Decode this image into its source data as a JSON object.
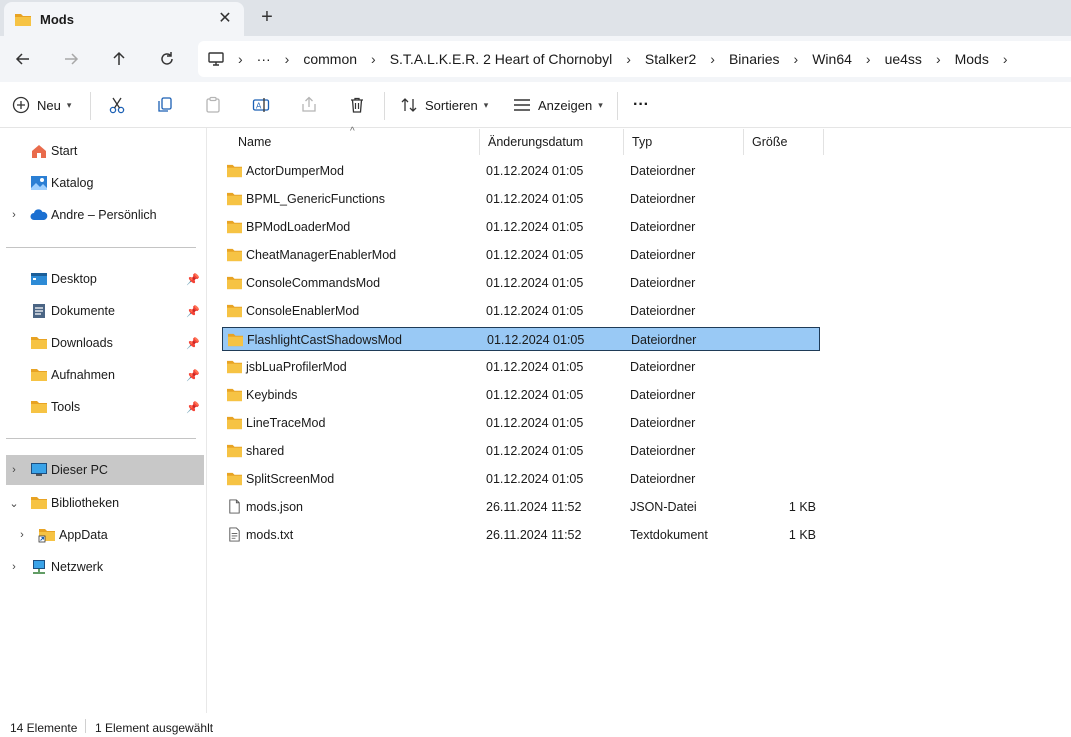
{
  "window": {
    "tab_title": "Mods",
    "tab_close_icon": "close-icon",
    "new_tab_icon": "plus-icon"
  },
  "nav": {
    "back_icon": "arrow-left-icon",
    "forward_icon": "arrow-right-icon",
    "up_icon": "arrow-up-icon",
    "refresh_icon": "refresh-icon",
    "breadcrumbs": [
      "common",
      "S.T.A.L.K.E.R. 2 Heart of Chornobyl",
      "Stalker2",
      "Binaries",
      "Win64",
      "ue4ss",
      "Mods"
    ],
    "overflow": "···"
  },
  "toolbar": {
    "new_label": "Neu",
    "sort_label": "Sortieren",
    "view_label": "Anzeigen",
    "more_label": "···"
  },
  "sidebar": {
    "groups": [
      [
        {
          "label": "Start",
          "icon": "home-icon",
          "chevron": ""
        },
        {
          "label": "Katalog",
          "icon": "gallery-icon",
          "chevron": ""
        },
        {
          "label": "Andre – Persönlich",
          "icon": "cloud-icon",
          "chevron": "›"
        }
      ],
      [
        {
          "label": "Desktop",
          "icon": "desktop-icon",
          "pinned": true
        },
        {
          "label": "Dokumente",
          "icon": "documents-icon",
          "pinned": true
        },
        {
          "label": "Downloads",
          "icon": "folder-icon",
          "pinned": true
        },
        {
          "label": "Aufnahmen",
          "icon": "folder-icon",
          "pinned": true
        },
        {
          "label": "Tools",
          "icon": "folder-icon",
          "pinned": true
        }
      ],
      [
        {
          "label": "Dieser PC",
          "icon": "pc-icon",
          "chevron": "›",
          "selected": true
        },
        {
          "label": "Bibliotheken",
          "icon": "folder-icon",
          "chevron": "⌄"
        },
        {
          "label": "AppData",
          "icon": "folder-shortcut-icon",
          "chevron": "›",
          "indent": true
        },
        {
          "label": "Netzwerk",
          "icon": "network-icon",
          "chevron": "›"
        }
      ]
    ]
  },
  "columns": {
    "name": "Name",
    "date": "Änderungsdatum",
    "type": "Typ",
    "size": "Größe"
  },
  "files": [
    {
      "name": "ActorDumperMod",
      "date": "01.12.2024 01:05",
      "type": "Dateiordner",
      "size": "",
      "icon": "folder-icon"
    },
    {
      "name": "BPML_GenericFunctions",
      "date": "01.12.2024 01:05",
      "type": "Dateiordner",
      "size": "",
      "icon": "folder-icon"
    },
    {
      "name": "BPModLoaderMod",
      "date": "01.12.2024 01:05",
      "type": "Dateiordner",
      "size": "",
      "icon": "folder-icon"
    },
    {
      "name": "CheatManagerEnablerMod",
      "date": "01.12.2024 01:05",
      "type": "Dateiordner",
      "size": "",
      "icon": "folder-icon"
    },
    {
      "name": "ConsoleCommandsMod",
      "date": "01.12.2024 01:05",
      "type": "Dateiordner",
      "size": "",
      "icon": "folder-icon"
    },
    {
      "name": "ConsoleEnablerMod",
      "date": "01.12.2024 01:05",
      "type": "Dateiordner",
      "size": "",
      "icon": "folder-icon"
    },
    {
      "name": "FlashlightCastShadowsMod",
      "date": "01.12.2024 01:05",
      "type": "Dateiordner",
      "size": "",
      "icon": "folder-icon",
      "selected": true
    },
    {
      "name": "jsbLuaProfilerMod",
      "date": "01.12.2024 01:05",
      "type": "Dateiordner",
      "size": "",
      "icon": "folder-icon"
    },
    {
      "name": "Keybinds",
      "date": "01.12.2024 01:05",
      "type": "Dateiordner",
      "size": "",
      "icon": "folder-icon"
    },
    {
      "name": "LineTraceMod",
      "date": "01.12.2024 01:05",
      "type": "Dateiordner",
      "size": "",
      "icon": "folder-icon"
    },
    {
      "name": "shared",
      "date": "01.12.2024 01:05",
      "type": "Dateiordner",
      "size": "",
      "icon": "folder-icon"
    },
    {
      "name": "SplitScreenMod",
      "date": "01.12.2024 01:05",
      "type": "Dateiordner",
      "size": "",
      "icon": "folder-icon"
    },
    {
      "name": "mods.json",
      "date": "26.11.2024 11:52",
      "type": "JSON-Datei",
      "size": "1 KB",
      "icon": "file-icon"
    },
    {
      "name": "mods.txt",
      "date": "26.11.2024 11:52",
      "type": "Textdokument",
      "size": "1 KB",
      "icon": "text-file-icon"
    }
  ],
  "status": {
    "count": "14 Elemente",
    "selection": "1 Element ausgewählt"
  },
  "colors": {
    "selection_fill": "#99c9f5",
    "selection_border": "#1f3b57",
    "folder_yellow": "#f6c344",
    "sidebar_selected": "#c8c8c8"
  }
}
